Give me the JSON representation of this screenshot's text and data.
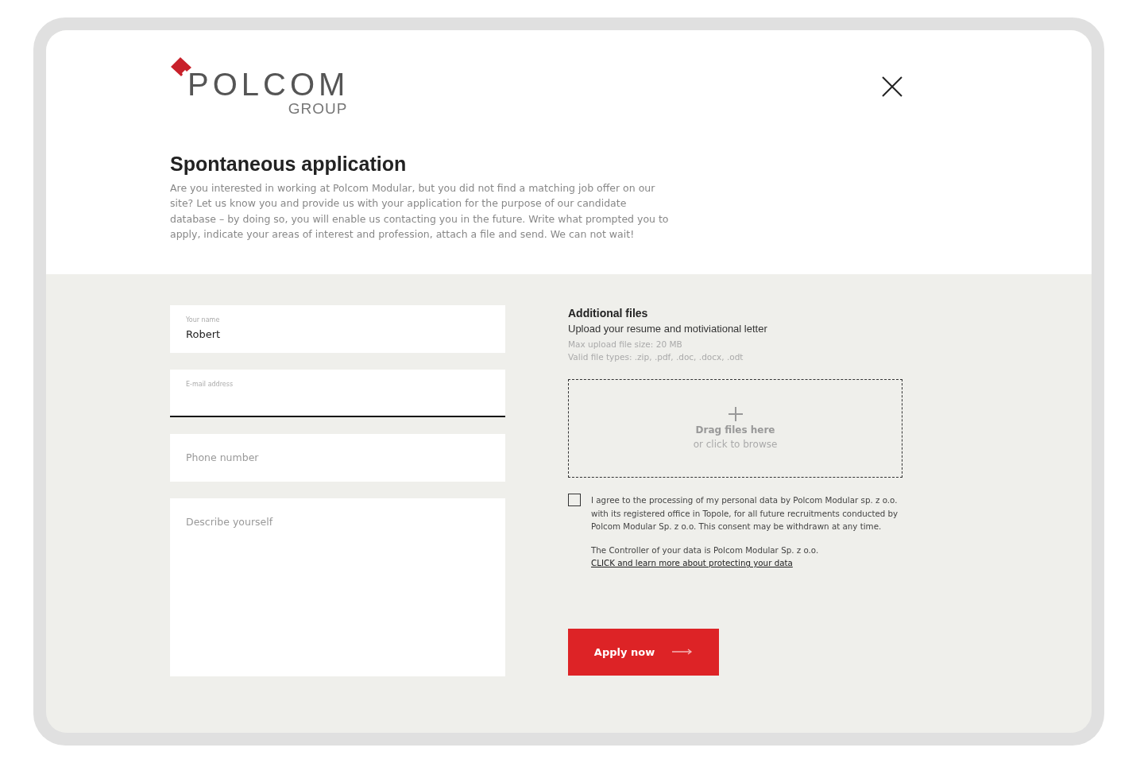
{
  "logo": {
    "name": "POLCOM",
    "subtitle": "GROUP"
  },
  "title": "Spontaneous application",
  "intro": "Are you interested in working at Polcom Modular, but you did not find a matching job offer on our site? Let us know you and provide us with your application for the purpose of our candidate database – by doing so, you will enable us contacting you in the future. Write what prompted you to apply, indicate your areas of interest and profession, attach a file and send. We can not wait!",
  "fields": [
    {
      "kind": "input",
      "label": "Your name",
      "value": "Robert",
      "focused": false
    },
    {
      "kind": "input",
      "label": "E-mail address",
      "focused": true
    },
    {
      "kind": "input",
      "placeholder": "Phone number",
      "focused": false
    },
    {
      "kind": "textarea",
      "placeholder": "Describe yourself",
      "focused": false
    }
  ],
  "files": {
    "heading": "Additional files",
    "subheading": "Upload your resume and motiviational letter",
    "notes": [
      "Max upload file size: 20 MB",
      "Valid file types: .zip, .pdf, .doc, .docx, .odt"
    ],
    "drop_title": "Drag files here",
    "drop_hint": "or click to browse"
  },
  "consent": {
    "checked": false,
    "text": "I agree to the processing of my personal data by Polcom Modular sp. z o.o. with its registered office in Topole, for all future recruitments conducted by Polcom Modular Sp. z o.o. This consent may be withdrawn at any time.",
    "controller": "The Controller of your data is Polcom Modular Sp. z o.o.",
    "link": "CLICK and learn more about protecting your data"
  },
  "submit": "Apply now"
}
